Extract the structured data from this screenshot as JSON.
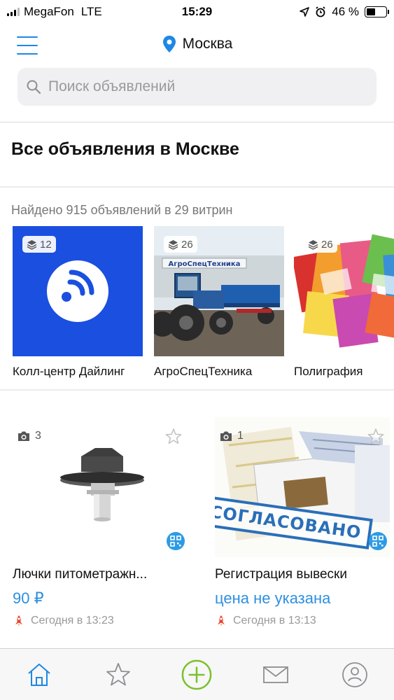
{
  "status_bar": {
    "carrier": "MegaFon",
    "network": "LTE",
    "time": "15:29",
    "battery": "46 %",
    "battery_level": 0.46
  },
  "header": {
    "city": "Москва",
    "search_placeholder": "Поиск объявлений"
  },
  "page_title": "Все объявления в Москве",
  "found_text": "Найдено 915 объявлений в 29 витрин",
  "showcases": [
    {
      "label": "Колл-центр Дайлинг",
      "count": "12"
    },
    {
      "label": "АгроСпецТехника",
      "count": "26"
    },
    {
      "label": "Полиграфия",
      "count": "26"
    }
  ],
  "showcase_images": {
    "truck_sign": "АгроСпецТехника"
  },
  "listings": [
    {
      "title": "Лючки питометражн...",
      "price": "90 ₽",
      "date": "Сегодня в 13:23",
      "photos": "3"
    },
    {
      "title": "Регистрация вывески",
      "price": "цена не указана",
      "date": "Сегодня в 13:13",
      "photos": "1",
      "stamp": "СОГЛАСОВАНО"
    }
  ],
  "tabbar": [
    "home",
    "favorites",
    "add",
    "messages",
    "profile"
  ],
  "colors": {
    "accent": "#1e88e5",
    "price": "#2d8fe0",
    "add_button": "#7cc12c",
    "callcenter_bg": "#1a4fe0"
  }
}
